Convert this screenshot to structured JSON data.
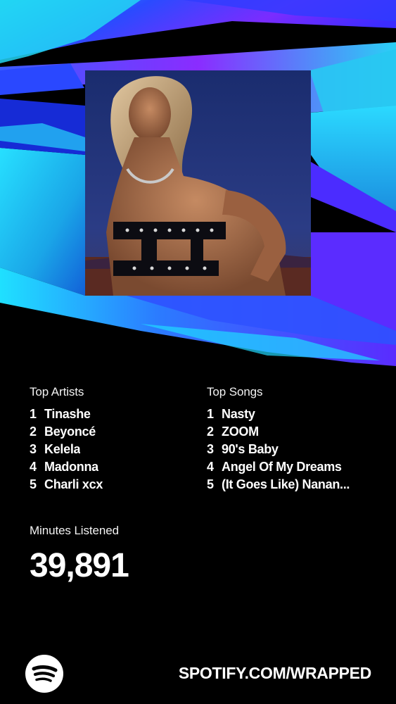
{
  "album": {
    "image_alt": "Album cover artwork"
  },
  "top_artists": {
    "heading": "Top Artists",
    "items": [
      {
        "rank": "1",
        "name": "Tinashe"
      },
      {
        "rank": "2",
        "name": "Beyoncé"
      },
      {
        "rank": "3",
        "name": "Kelela"
      },
      {
        "rank": "4",
        "name": "Madonna"
      },
      {
        "rank": "5",
        "name": "Charli xcx"
      }
    ]
  },
  "top_songs": {
    "heading": "Top Songs",
    "items": [
      {
        "rank": "1",
        "name": "Nasty"
      },
      {
        "rank": "2",
        "name": "ZOOM"
      },
      {
        "rank": "3",
        "name": "90's Baby"
      },
      {
        "rank": "4",
        "name": "Angel Of My Dreams"
      },
      {
        "rank": "5",
        "name": "(It Goes Like) Nanan..."
      }
    ]
  },
  "minutes": {
    "label": "Minutes Listened",
    "value": "39,891"
  },
  "footer": {
    "logo_icon": "spotify-logo-icon",
    "url": "SPOTIFY.COM/WRAPPED"
  },
  "colors": {
    "background": "#000000",
    "accent_cyan": "#1fd3f0",
    "accent_blue": "#2a4bff",
    "accent_violet": "#7a2cff",
    "text": "#ffffff"
  }
}
